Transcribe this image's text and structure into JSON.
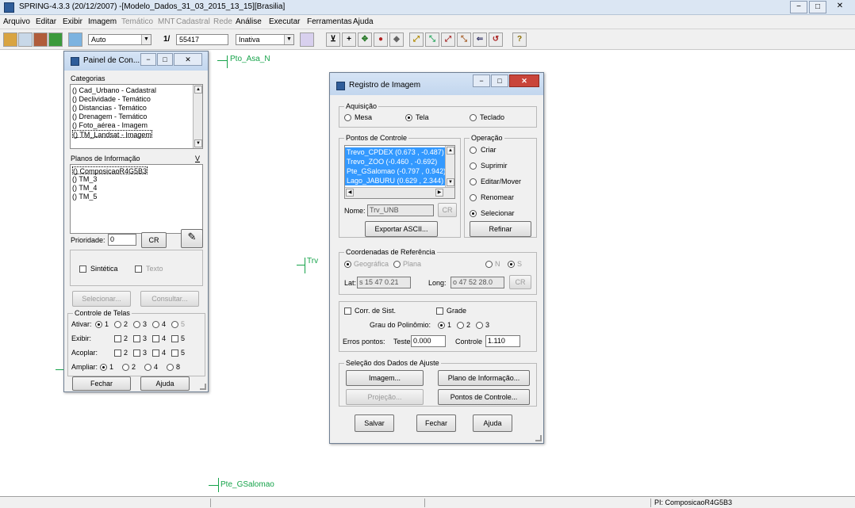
{
  "window": {
    "title": "SPRING-4.3.3 (20/12/2007) -[Modelo_Dados_31_03_2015_13_15][Brasilia]",
    "minimize": "−",
    "maximize": "□",
    "close": "✕"
  },
  "menu": {
    "items": [
      {
        "label": "Arquivo",
        "enabled": true
      },
      {
        "label": "Editar",
        "enabled": true
      },
      {
        "label": "Exibir",
        "enabled": true
      },
      {
        "label": "Imagem",
        "enabled": true
      },
      {
        "label": "Temático",
        "enabled": false
      },
      {
        "label": "MNT",
        "enabled": false
      },
      {
        "label": "Cadastral",
        "enabled": false
      },
      {
        "label": "Rede",
        "enabled": false
      },
      {
        "label": "Análise",
        "enabled": true
      },
      {
        "label": "Executar",
        "enabled": true
      },
      {
        "label": "Ferramentas",
        "enabled": true
      },
      {
        "label": "Ajuda",
        "enabled": true
      }
    ]
  },
  "toolbar": {
    "mode_value": "Auto",
    "scale_prefix": "1/",
    "scale_value": "55417",
    "status_value": "Inativa",
    "help_glyph": "?"
  },
  "map": {
    "labels": [
      "Pto_Asa_N",
      "Trv",
      "Pte_GSalomao"
    ]
  },
  "status": {
    "pi": "PI: ComposicaoR4G5B3"
  },
  "panel": {
    "title": "Painel de Con...",
    "categorias_label": "Categorias",
    "categorias": [
      "() Cad_Urbano - Cadastral",
      "() Declividade - Temático",
      "() Distancias - Temático",
      "() Drenagem - Temático",
      "() Foto_aérea - Imagem",
      "() TM_Landsat - Imagem"
    ],
    "planos_label": "Planos de Informação",
    "planos_v": "V",
    "planos": [
      "() ComposicaoR4G5B3",
      "() TM_3",
      "() TM_4",
      "() TM_5"
    ],
    "prioridade_label": "Prioridade:",
    "prioridade_value": "0",
    "cr": "CR",
    "sintetica": "Sintética",
    "texto": "Texto",
    "selecionar": "Selecionar...",
    "consultar": "Consultar...",
    "controle_label": "Controle de Telas",
    "ativar_label": "Ativar:",
    "exibir_label": "Exibir:",
    "acoplar_label": "Acoplar:",
    "ampliar_label": "Ampliar:",
    "n1": "1",
    "n2": "2",
    "n3": "3",
    "n4": "4",
    "n5": "5",
    "n8": "8",
    "fechar": "Fechar",
    "ajuda": "Ajuda"
  },
  "registro": {
    "title": "Registro de Imagem",
    "aquisicao_label": "Aquisição",
    "mesa": "Mesa",
    "tela": "Tela",
    "teclado": "Teclado",
    "pontos_label": "Pontos de Controle",
    "pontos": [
      "Trevo_CPDEX (0.673 , -0.487)",
      "Trevo_ZOO (-0.460 , -0.692)",
      "Pte_GSalomao (-0.797 , 0.942)",
      "Lago_JABURU (0.629 , 2.344)"
    ],
    "nome_label": "Nome:",
    "nome_value": "Trv_UNB",
    "cr": "CR",
    "exportar": "Exportar ASCII...",
    "operacao_label": "Operação",
    "op_criar": "Criar",
    "op_suprimir": "Suprimir",
    "op_editar": "Editar/Mover",
    "op_renomear": "Renomear",
    "op_selecionar": "Selecionar",
    "refinar": "Refinar",
    "coord_label": "Coordenadas de Referência",
    "geografica": "Geográfica",
    "plana": "Plana",
    "n": "N",
    "s": "S",
    "lat_label": "Lat:",
    "lat_value": "s 15 47 0.21",
    "long_label": "Long:",
    "long_value": "o 47 52 28.0",
    "corr_sist": "Corr. de Sist.",
    "grade": "Grade",
    "grau_label": "Grau do Polinômio:",
    "g1": "1",
    "g2": "2",
    "g3": "3",
    "erros_label": "Erros pontos:",
    "teste_label": "Teste",
    "teste_value": "0.000",
    "controle_label": "Controle",
    "controle_value": "1.110",
    "selecao_label": "Seleção dos Dados de Ajuste",
    "imagem": "Imagem...",
    "plano": "Plano de Informação...",
    "projecao": "Projeção...",
    "pontos_btn": "Pontos de Controle...",
    "salvar": "Salvar",
    "fechar": "Fechar",
    "ajuda": "Ajuda"
  }
}
